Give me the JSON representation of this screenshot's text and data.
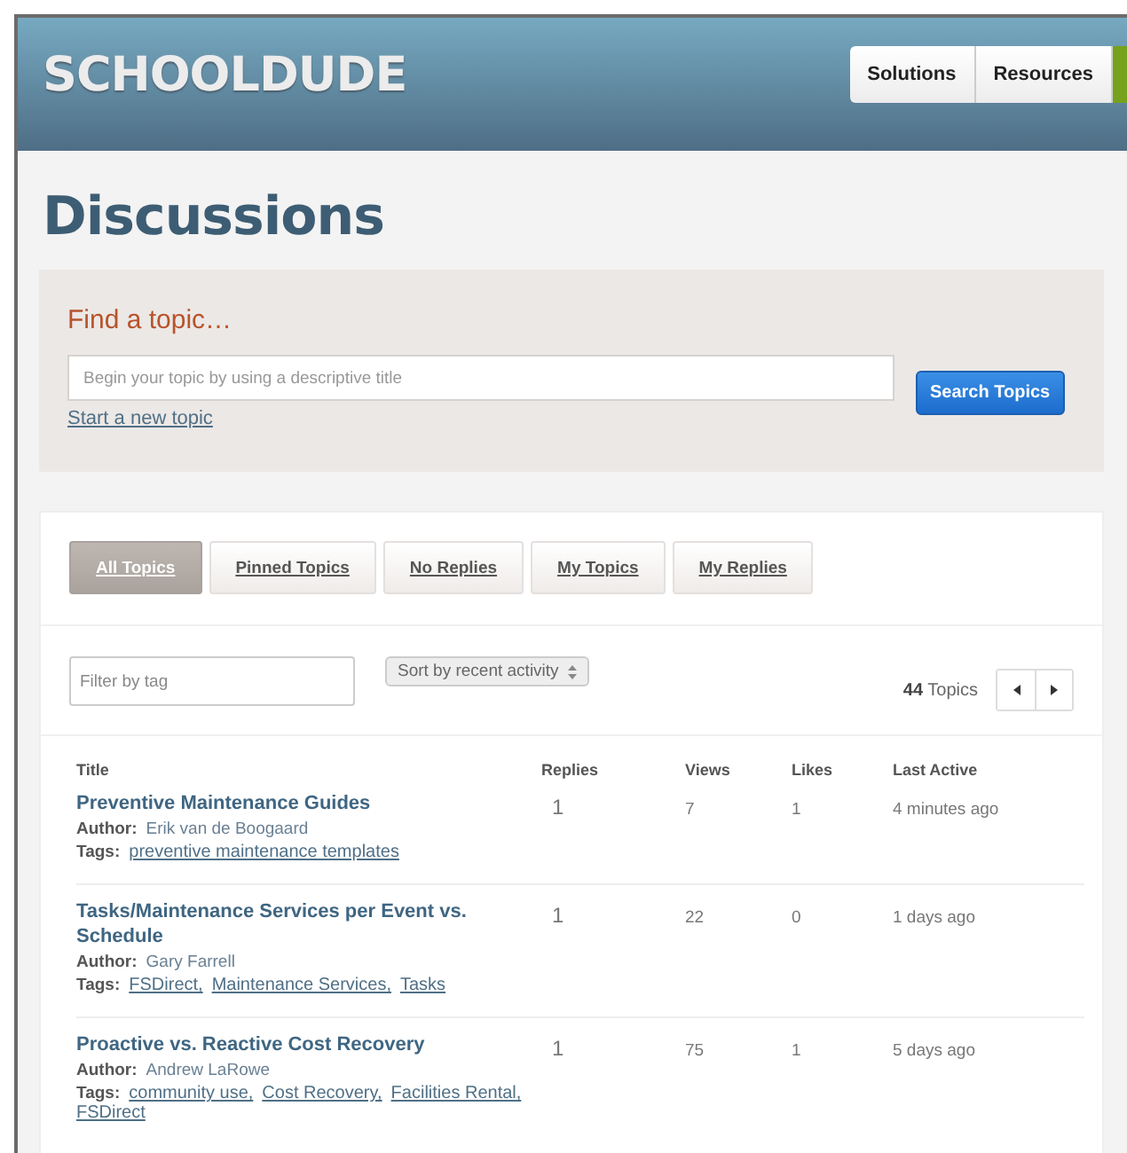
{
  "logo": "SCHOOLDUDE",
  "nav": [
    {
      "label": "Solutions"
    },
    {
      "label": "Resources"
    }
  ],
  "page_title": "Discussions",
  "find": {
    "heading": "Find a topic…",
    "placeholder": "Begin your topic by using a descriptive title",
    "button": "Search Topics",
    "link": "Start a new topic"
  },
  "tabs": [
    {
      "label": "All Topics",
      "selected": true
    },
    {
      "label": "Pinned Topics",
      "selected": false
    },
    {
      "label": "No Replies",
      "selected": false
    },
    {
      "label": "My Topics",
      "selected": false
    },
    {
      "label": "My Replies",
      "selected": false
    }
  ],
  "filter": {
    "placeholder": "Filter by tag"
  },
  "sort": {
    "value": "Sort by recent activity"
  },
  "count": {
    "number": "44",
    "label": "Topics"
  },
  "table": {
    "columns": [
      "Title",
      "Replies",
      "Views",
      "Likes",
      "Last Active"
    ],
    "rows": [
      {
        "title": "Preventive Maintenance Guides",
        "author_label": "Author:",
        "tags_label": "Tags:",
        "author": "Erik van de Boogaard",
        "tags": [
          "preventive maintenance templates"
        ],
        "replies": "1",
        "views": "7",
        "likes": "1",
        "last_active": "4 minutes ago"
      },
      {
        "title": "Tasks/Maintenance Services per Event vs. Schedule",
        "author_label": "Author:",
        "tags_label": "Tags:",
        "author": "Gary Farrell",
        "tags": [
          "FSDirect,",
          "Maintenance Services,",
          "Tasks"
        ],
        "replies": "1",
        "views": "22",
        "likes": "0",
        "last_active": "1 days ago"
      },
      {
        "title": "Proactive vs. Reactive Cost Recovery",
        "author_label": "Author:",
        "tags_label": "Tags:",
        "author": "Andrew LaRowe",
        "tags": [
          "community use,",
          "Cost Recovery,",
          "Facilities Rental,",
          "FSDirect"
        ],
        "replies": "1",
        "views": "75",
        "likes": "1",
        "last_active": "5 days ago"
      }
    ]
  }
}
